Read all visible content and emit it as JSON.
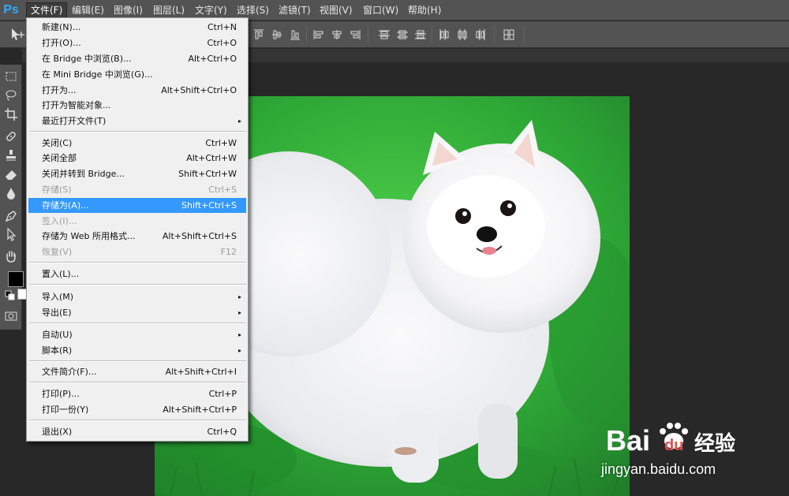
{
  "app": {
    "logo": "Ps"
  },
  "menubar": [
    {
      "label": "文件(F)",
      "open": true
    },
    {
      "label": "编辑(E)"
    },
    {
      "label": "图像(I)"
    },
    {
      "label": "图层(L)"
    },
    {
      "label": "文字(Y)"
    },
    {
      "label": "选择(S)"
    },
    {
      "label": "滤镜(T)"
    },
    {
      "label": "视图(V)"
    },
    {
      "label": "窗口(W)"
    },
    {
      "label": "帮助(H)"
    }
  ],
  "file_menu": [
    {
      "label": "新建(N)...",
      "shortcut": "Ctrl+N"
    },
    {
      "label": "打开(O)...",
      "shortcut": "Ctrl+O"
    },
    {
      "label": "在 Bridge 中浏览(B)...",
      "shortcut": "Alt+Ctrl+O"
    },
    {
      "label": "在 Mini Bridge 中浏览(G)...",
      "shortcut": ""
    },
    {
      "label": "打开为...",
      "shortcut": "Alt+Shift+Ctrl+O"
    },
    {
      "label": "打开为智能对象...",
      "shortcut": ""
    },
    {
      "label": "最近打开文件(T)",
      "shortcut": "",
      "submenu": true
    },
    {
      "label": "关闭(C)",
      "shortcut": "Ctrl+W"
    },
    {
      "label": "关闭全部",
      "shortcut": "Alt+Ctrl+W"
    },
    {
      "label": "关闭并转到 Bridge...",
      "shortcut": "Shift+Ctrl+W"
    },
    {
      "label": "存储(S)",
      "shortcut": "Ctrl+S",
      "disabled": true
    },
    {
      "label": "存储为(A)...",
      "shortcut": "Shift+Ctrl+S",
      "highlighted": true
    },
    {
      "label": "签入(I)...",
      "shortcut": "",
      "disabled": true
    },
    {
      "label": "存储为 Web 所用格式...",
      "shortcut": "Alt+Shift+Ctrl+S"
    },
    {
      "label": "恢复(V)",
      "shortcut": "F12",
      "disabled": true
    },
    {
      "label": "置入(L)...",
      "shortcut": ""
    },
    {
      "label": "导入(M)",
      "shortcut": "",
      "submenu": true
    },
    {
      "label": "导出(E)",
      "shortcut": "",
      "submenu": true
    },
    {
      "label": "自动(U)",
      "shortcut": "",
      "submenu": true
    },
    {
      "label": "脚本(R)",
      "shortcut": "",
      "submenu": true
    },
    {
      "label": "文件简介(F)...",
      "shortcut": "Alt+Shift+Ctrl+I"
    },
    {
      "label": "打印(P)...",
      "shortcut": "Ctrl+P"
    },
    {
      "label": "打印一份(Y)",
      "shortcut": "Alt+Shift+Ctrl+P"
    },
    {
      "label": "退出(X)",
      "shortcut": "Ctrl+Q"
    }
  ],
  "submenu_arrow": "▸",
  "colors": {
    "foreground": "#000000",
    "background": "#ffffff",
    "highlight": "#3399ff",
    "ps_blue": "#30a8ff"
  },
  "tools": [
    "marquee-icon",
    "lasso-icon",
    "crop-icon",
    "healing-brush-icon",
    "stamp-icon",
    "eraser-icon",
    "blur-icon",
    "pen-icon",
    "path-select-icon",
    "hand-icon"
  ],
  "watermark": {
    "logo_text": "Bai",
    "logo_text2": "du",
    "logo_cn": "经验",
    "url": "jingyan.baidu.com"
  }
}
